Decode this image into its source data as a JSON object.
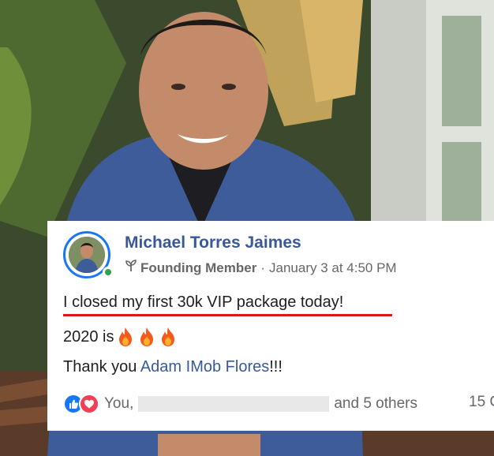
{
  "post": {
    "author_name": "Michael Torres Jaimes",
    "badge": "Founding Member",
    "separator": "·",
    "timestamp": "January 3 at 4:50 PM",
    "line1": "I closed my first 30k VIP package today!",
    "line2_text": "2020 is",
    "line3_prefix": "Thank you ",
    "line3_mention": "Adam IMob Flores",
    "line3_suffix": "!!!",
    "reactions_prefix": "You,",
    "reactions_suffix": "and 5 others",
    "comment_count": "15 C",
    "icons": [
      "badge-sprout-icon",
      "fire-icon",
      "like-reaction-icon",
      "love-reaction-icon"
    ]
  },
  "colors": {
    "link": "#385898",
    "underline": "#e0141b",
    "online": "#31a24c",
    "like": "#1877f2",
    "love": "#f33e58"
  }
}
